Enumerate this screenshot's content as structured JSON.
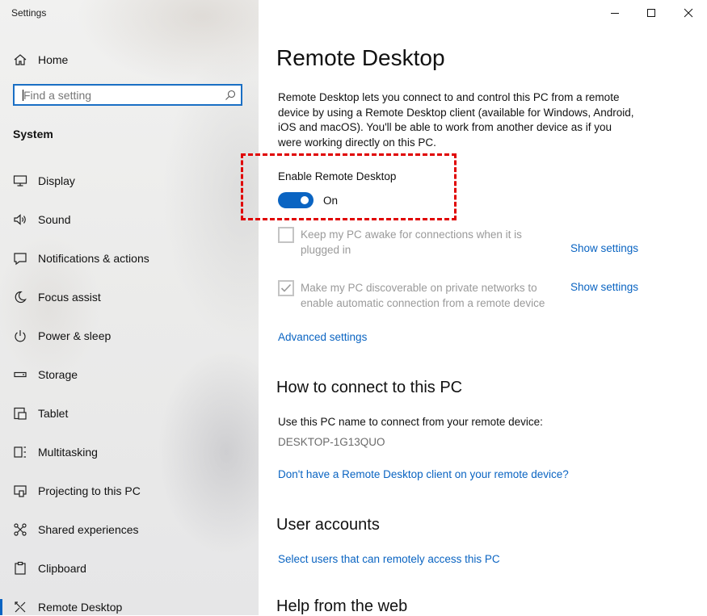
{
  "window": {
    "title": "Settings",
    "minimize_icon": "minimize-icon",
    "maximize_icon": "maximize-icon",
    "close_icon": "close-icon"
  },
  "sidebar": {
    "home_label": "Home",
    "home_icon": "home-icon",
    "search": {
      "placeholder": "Find a setting",
      "value": "",
      "icon": "search-icon"
    },
    "section_title": "System",
    "items": [
      {
        "label": "Display",
        "icon": "display-icon"
      },
      {
        "label": "Sound",
        "icon": "sound-icon"
      },
      {
        "label": "Notifications & actions",
        "icon": "notifications-icon"
      },
      {
        "label": "Focus assist",
        "icon": "focus-assist-icon"
      },
      {
        "label": "Power & sleep",
        "icon": "power-icon"
      },
      {
        "label": "Storage",
        "icon": "storage-icon"
      },
      {
        "label": "Tablet",
        "icon": "tablet-icon"
      },
      {
        "label": "Multitasking",
        "icon": "multitasking-icon"
      },
      {
        "label": "Projecting to this PC",
        "icon": "projecting-icon"
      },
      {
        "label": "Shared experiences",
        "icon": "shared-experiences-icon"
      },
      {
        "label": "Clipboard",
        "icon": "clipboard-icon"
      },
      {
        "label": "Remote Desktop",
        "icon": "remote-desktop-icon",
        "active": true
      }
    ]
  },
  "main": {
    "title": "Remote Desktop",
    "description": "Remote Desktop lets you connect to and control this PC from a remote device by using a Remote Desktop client (available for Windows, Android, iOS and macOS). You'll be able to work from another device as if you were working directly on this PC.",
    "enable_label": "Enable Remote Desktop",
    "toggle_state": "On",
    "keep_awake": {
      "label": "Keep my PC awake for connections when it is plugged in",
      "checked": false,
      "link": "Show settings"
    },
    "discoverable": {
      "label": "Make my PC discoverable on private networks to enable automatic connection from a remote device",
      "checked": true,
      "link": "Show settings"
    },
    "advanced_link": "Advanced settings",
    "how_to_connect": {
      "heading": "How to connect to this PC",
      "text": "Use this PC name to connect from your remote device:",
      "pc_name": "DESKTOP-1G13QUO",
      "link": "Don't have a Remote Desktop client on your remote device?"
    },
    "user_accounts": {
      "heading": "User accounts",
      "link": "Select users that can remotely access this PC"
    },
    "help": {
      "heading": "Help from the web"
    }
  },
  "colors": {
    "accent": "#0a64c2",
    "highlight_border": "#e00000",
    "disabled_text": "#9a9a9a"
  }
}
